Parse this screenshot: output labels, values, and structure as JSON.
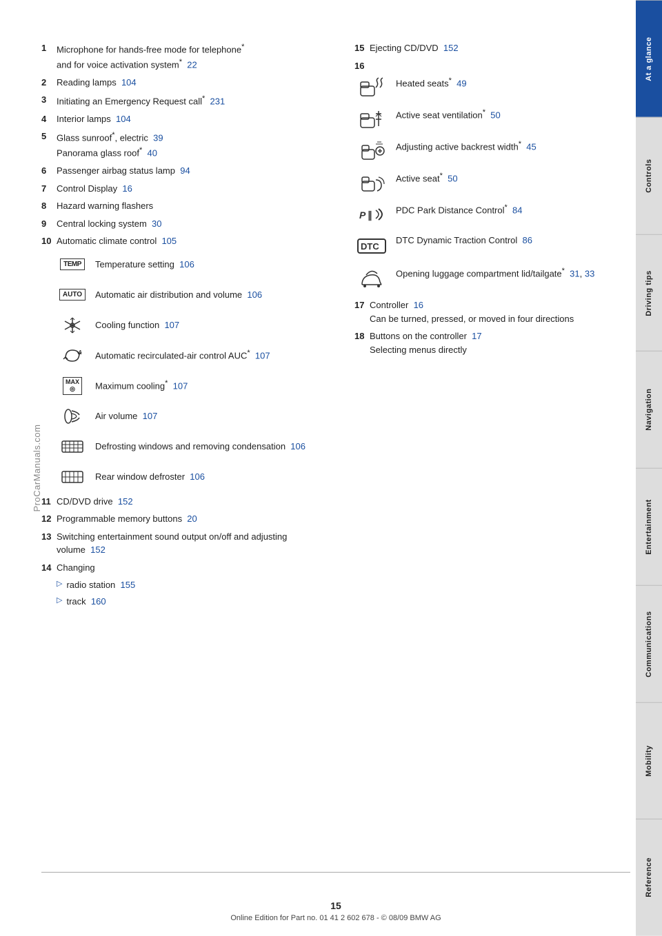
{
  "sidebar": {
    "tabs": [
      {
        "label": "At a glance",
        "active": true
      },
      {
        "label": "Controls",
        "active": false
      },
      {
        "label": "Driving tips",
        "active": false
      },
      {
        "label": "Navigation",
        "active": false
      },
      {
        "label": "Entertainment",
        "active": false
      },
      {
        "label": "Communications",
        "active": false
      },
      {
        "label": "Mobility",
        "active": false
      },
      {
        "label": "Reference",
        "active": false
      }
    ]
  },
  "watermark": "ProCarManuals.com",
  "left_items": [
    {
      "num": "1",
      "text": "Microphone for hands-free mode for telephone",
      "star": true,
      "continuation": "and for voice activation system",
      "cont_star": true,
      "page": "22"
    },
    {
      "num": "2",
      "text": "Reading lamps",
      "page": "104"
    },
    {
      "num": "3",
      "text": "Initiating an Emergency Request call",
      "star": true,
      "page": "231"
    },
    {
      "num": "4",
      "text": "Interior lamps",
      "page": "104"
    },
    {
      "num": "5",
      "text": "Glass sunroof*, electric",
      "page": "39",
      "subtext": "Panorama glass roof*",
      "subpage": "40"
    },
    {
      "num": "6",
      "text": "Passenger airbag status lamp",
      "page": "94"
    },
    {
      "num": "7",
      "text": "Control Display",
      "page": "16"
    },
    {
      "num": "8",
      "text": "Hazard warning flashers",
      "page": ""
    },
    {
      "num": "9",
      "text": "Central locking system",
      "page": "30"
    },
    {
      "num": "10",
      "text": "Automatic climate control",
      "page": "105"
    }
  ],
  "climate_rows": [
    {
      "icon_type": "text",
      "icon_text": "TEMP",
      "text": "Temperature setting",
      "page": "106"
    },
    {
      "icon_type": "text",
      "icon_text": "AUTO",
      "text": "Automatic air distribution and volume",
      "page": "106"
    },
    {
      "icon_type": "svg_snowflake",
      "icon_text": "❄",
      "text": "Cooling function",
      "page": "107"
    },
    {
      "icon_type": "svg_recirc",
      "icon_text": "⟳A",
      "text": "Automatic recirculated-air control AUC*",
      "page": "107"
    },
    {
      "icon_type": "text",
      "icon_text": "MAX\n◎",
      "text": "Maximum cooling*",
      "page": "107"
    },
    {
      "icon_type": "svg_airvol",
      "icon_text": "≋",
      "text": "Air volume",
      "page": "107"
    },
    {
      "icon_type": "svg_defrost",
      "icon_text": "⊞",
      "text": "Defrosting windows and removing condensation",
      "page": "106"
    },
    {
      "icon_type": "svg_rear",
      "icon_text": "⊟",
      "text": "Rear window defroster",
      "page": "106"
    }
  ],
  "bottom_items": [
    {
      "num": "11",
      "text": "CD/DVD drive",
      "page": "152"
    },
    {
      "num": "12",
      "text": "Programmable memory buttons",
      "page": "20"
    },
    {
      "num": "13",
      "text": "Switching entertainment sound output on/off and adjusting volume",
      "page": "152"
    },
    {
      "num": "14",
      "text": "Changing"
    },
    {
      "num": "14a",
      "arrow": true,
      "text": "radio station",
      "page": "155"
    },
    {
      "num": "14b",
      "arrow": true,
      "text": "track",
      "page": "160"
    }
  ],
  "right_items": [
    {
      "num": "15",
      "text": "Ejecting CD/DVD",
      "page": "152"
    },
    {
      "num": "16",
      "label": "16"
    },
    "seat_section",
    {
      "num": "17",
      "text": "Controller",
      "page": "16",
      "sub": "Can be turned, pressed, or moved in four directions"
    },
    {
      "num": "18",
      "text": "Buttons on the controller",
      "page": "17",
      "sub": "Selecting menus directly"
    }
  ],
  "seat_items": [
    {
      "icon": "seat_heat",
      "text": "Heated seats*",
      "page": "49"
    },
    {
      "icon": "seat_vent",
      "text": "Active seat ventilation*",
      "page": "50"
    },
    {
      "icon": "backrest",
      "text": "Adjusting active backrest width*",
      "page": "45"
    },
    {
      "icon": "active_seat",
      "text": "Active seat*",
      "page": "50"
    },
    {
      "icon": "pdc",
      "text": "PDC Park Distance Control*",
      "page": "84"
    },
    {
      "icon": "dtc",
      "text": "DTC Dynamic Traction Control",
      "page": "86"
    },
    {
      "icon": "luggage",
      "text": "Opening luggage compartment lid/tailgate*",
      "page1": "31",
      "page2": "33"
    }
  ],
  "page_number": "15",
  "footer_text": "Online Edition for Part no. 01 41 2 602 678 - © 08/09 BMW AG"
}
